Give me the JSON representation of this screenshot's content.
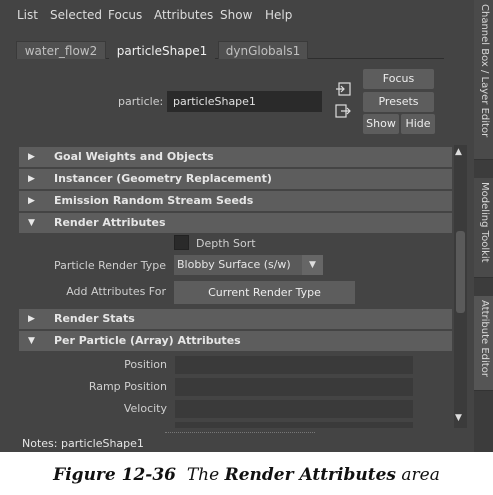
{
  "menu": [
    "List",
    "Selected",
    "Focus",
    "Attributes",
    "Show",
    "Help"
  ],
  "tabs": [
    {
      "label": "water_flow2",
      "active": false
    },
    {
      "label": "particleShape1",
      "active": true
    },
    {
      "label": "dynGlobals1",
      "active": false
    }
  ],
  "particle": {
    "label": "particle:",
    "value": "particleShape1"
  },
  "buttons": {
    "focus": "Focus",
    "presets": "Presets",
    "show": "Show",
    "hide": "Hide"
  },
  "sections": {
    "goal_weights": "Goal Weights and Objects",
    "instancer": "Instancer (Geometry Replacement)",
    "emission_seeds": "Emission Random Stream Seeds",
    "render_attributes": "Render Attributes",
    "render_stats": "Render Stats",
    "per_particle": "Per Particle (Array) Attributes"
  },
  "render": {
    "depth_sort_label": "Depth Sort",
    "depth_sort_checked": false,
    "particle_render_type_label": "Particle Render Type",
    "particle_render_type_value": "Blobby Surface (s/w)",
    "add_attributes_label": "Add Attributes For",
    "add_attributes_button": "Current Render Type"
  },
  "per_particle_fields": {
    "position": "Position",
    "ramp_position": "Ramp Position",
    "velocity": "Velocity"
  },
  "notes": "Notes:  particleShape1",
  "side_tabs": {
    "channel_box": "Channel Box / Layer Editor",
    "modeling_toolkit": "Modeling Toolkit",
    "attribute_editor": "Attribute Editor"
  },
  "caption": {
    "figure": "Figure 12-36",
    "the": "The",
    "bold": "Render Attributes",
    "rest": "area"
  }
}
